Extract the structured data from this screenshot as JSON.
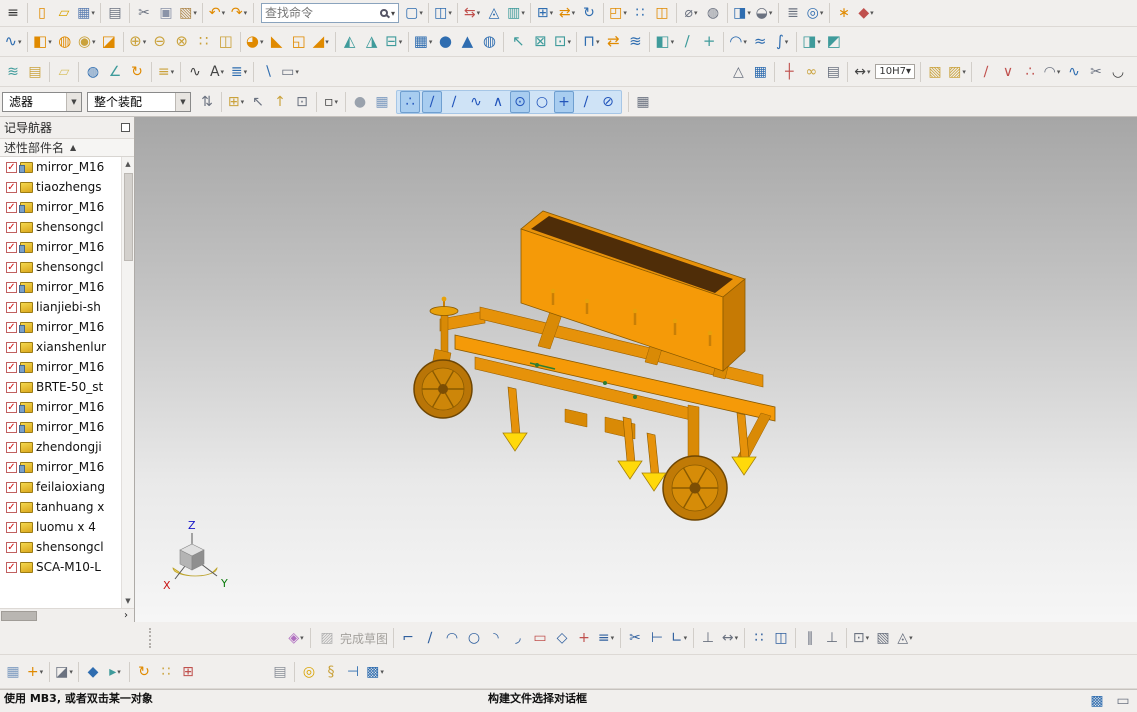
{
  "search": {
    "placeholder": "查找命令"
  },
  "filters": {
    "selection_filter": "滤器",
    "scope": "整个装配"
  },
  "navigator": {
    "title": "记导航器",
    "column_header": "述性部件名",
    "sort_indicator": "▲",
    "check_glyph": "✓",
    "scroll": {
      "up": "▲",
      "down": "▼",
      "right": "›"
    },
    "items": [
      {
        "label": "mirror_M16",
        "icon": "mirror",
        "checked": true
      },
      {
        "label": "tiaozhengs",
        "icon": "part",
        "checked": true
      },
      {
        "label": "mirror_M16",
        "icon": "mirror",
        "checked": true
      },
      {
        "label": "shensongcl",
        "icon": "part",
        "checked": true
      },
      {
        "label": "mirror_M16",
        "icon": "mirror",
        "checked": true
      },
      {
        "label": "shensongcl",
        "icon": "part",
        "checked": true
      },
      {
        "label": "mirror_M16",
        "icon": "mirror",
        "checked": true
      },
      {
        "label": "lianjiebi-sh",
        "icon": "part",
        "checked": true
      },
      {
        "label": "mirror_M16",
        "icon": "mirror",
        "checked": true
      },
      {
        "label": "xianshenlur",
        "icon": "part",
        "checked": true
      },
      {
        "label": "mirror_M16",
        "icon": "mirror",
        "checked": true
      },
      {
        "label": "BRTE-50_st",
        "icon": "part",
        "checked": true
      },
      {
        "label": "mirror_M16",
        "icon": "mirror",
        "checked": true
      },
      {
        "label": "mirror_M16",
        "icon": "mirror",
        "checked": true
      },
      {
        "label": "zhendongji",
        "icon": "part",
        "checked": true
      },
      {
        "label": "mirror_M16",
        "icon": "mirror",
        "checked": true
      },
      {
        "label": "feilaioxiang",
        "icon": "part",
        "checked": true
      },
      {
        "label": "tanhuang x",
        "icon": "part",
        "checked": true
      },
      {
        "label": "luomu x 4",
        "icon": "part",
        "checked": true
      },
      {
        "label": "shensongcl",
        "icon": "part",
        "checked": true
      },
      {
        "label": "SCA-M10-L",
        "icon": "part",
        "checked": true
      }
    ]
  },
  "sketch_toolbar": {
    "finish_label": "完成草图"
  },
  "triad": {
    "x": "X",
    "y": "Y",
    "z": "Z"
  },
  "status_bar": {
    "left": "使用 MB3, 或者双击某一对象",
    "center": "构建文件选择对话框"
  },
  "colors": {
    "selection_highlight": "#cfe3f6",
    "model_orange": "#f59a08",
    "model_yellow": "#ffd90a"
  },
  "toolbars": {
    "row1_left": [
      {
        "n": "menu",
        "g": "≡",
        "c": "#333333"
      },
      {
        "t": "sep"
      },
      {
        "n": "new-file",
        "g": "▯",
        "c": "#e08a00"
      },
      {
        "n": "open-file",
        "g": "▱",
        "c": "#d9a300"
      },
      {
        "n": "save-file",
        "g": "▦",
        "c": "#5b7db1",
        "d": 1
      },
      {
        "t": "sep"
      },
      {
        "n": "print",
        "g": "▤",
        "c": "#6b7280"
      },
      {
        "t": "sep"
      },
      {
        "n": "cut",
        "g": "✂",
        "c": "#6b7280"
      },
      {
        "n": "copy",
        "g": "▣",
        "c": "#8a93a8"
      },
      {
        "n": "paste",
        "g": "▧",
        "c": "#b08a50",
        "d": 1
      },
      {
        "t": "sep"
      },
      {
        "n": "undo",
        "g": "↶",
        "c": "#e08a00",
        "d": 1
      },
      {
        "n": "redo",
        "g": "↷",
        "c": "#e08a00",
        "d": 1
      },
      {
        "t": "sep"
      }
    ],
    "row1_right": [
      {
        "n": "touch-mode",
        "g": "▢",
        "c": "#2f6db0",
        "d": 1
      },
      {
        "t": "sep"
      },
      {
        "n": "window-layout",
        "g": "◫",
        "c": "#2f6db0",
        "d": 1
      },
      {
        "t": "sep"
      },
      {
        "n": "move-object",
        "g": "⇆",
        "c": "#c0504d",
        "d": 1
      },
      {
        "n": "pmi",
        "g": "◬",
        "c": "#2f6db0"
      },
      {
        "n": "visual-report",
        "g": "▥",
        "c": "#3f9b9b",
        "d": 1
      },
      {
        "t": "sep"
      },
      {
        "n": "assembly-arrangements",
        "g": "⊞",
        "c": "#2f6db0",
        "d": 1
      },
      {
        "n": "move-component",
        "g": "⇄",
        "c": "#e08a00",
        "d": 1
      },
      {
        "n": "degrees-of-freedom",
        "g": "↻",
        "c": "#2f6db0"
      },
      {
        "t": "sep"
      },
      {
        "n": "new-component",
        "g": "◰",
        "c": "#e08a00",
        "d": 1
      },
      {
        "n": "pattern-component",
        "g": "∷",
        "c": "#2f6db0"
      },
      {
        "n": "mirror-assembly",
        "g": "◫",
        "c": "#e08a00"
      },
      {
        "t": "sep"
      },
      {
        "n": "measure-distance",
        "g": "⌀",
        "c": "#6b7280",
        "d": 1
      },
      {
        "n": "analysis",
        "g": "◍",
        "c": "#6b7280"
      },
      {
        "t": "sep"
      },
      {
        "n": "orient-view",
        "g": "◨",
        "c": "#2f6db0",
        "d": 1
      },
      {
        "n": "render-style",
        "g": "◒",
        "c": "#6b7280",
        "d": 1
      },
      {
        "t": "sep"
      },
      {
        "n": "layer-settings",
        "g": "≣",
        "c": "#6b7280"
      },
      {
        "n": "show-hide",
        "g": "◎",
        "c": "#2f6db0",
        "d": 1
      },
      {
        "t": "sep"
      },
      {
        "n": "user-tools",
        "g": "∗",
        "c": "#e08a00"
      },
      {
        "n": "touch-panel",
        "g": "◆",
        "c": "#c0504d",
        "d": 1
      }
    ],
    "row2": [
      {
        "n": "direct-sketch",
        "g": "∿",
        "c": "#2f6db0",
        "d": 1
      },
      {
        "t": "sep"
      },
      {
        "n": "extrude",
        "g": "◧",
        "c": "#e08a00",
        "d": 1
      },
      {
        "n": "revolve",
        "g": "◍",
        "c": "#e08a00"
      },
      {
        "n": "hole",
        "g": "◉",
        "c": "#caa23c",
        "d": 1
      },
      {
        "n": "rib",
        "g": "◪",
        "c": "#e08a00"
      },
      {
        "t": "sep"
      },
      {
        "n": "unite",
        "g": "⊕",
        "c": "#caa23c",
        "d": 1
      },
      {
        "n": "subtract",
        "g": "⊖",
        "c": "#caa23c"
      },
      {
        "n": "intersect",
        "g": "⊗",
        "c": "#caa23c"
      },
      {
        "n": "pattern-feature",
        "g": "∷",
        "c": "#caa23c"
      },
      {
        "n": "mirror-feature",
        "g": "◫",
        "c": "#caa23c"
      },
      {
        "t": "sep"
      },
      {
        "n": "edge-blend",
        "g": "◕",
        "c": "#e08a00",
        "d": 1
      },
      {
        "n": "chamfer",
        "g": "◣",
        "c": "#e08a00"
      },
      {
        "n": "shell",
        "g": "◱",
        "c": "#e08a00"
      },
      {
        "n": "draft",
        "g": "◢",
        "c": "#e08a00",
        "d": 1
      },
      {
        "t": "sep"
      },
      {
        "n": "trim-body",
        "g": "◭",
        "c": "#3f9b9b"
      },
      {
        "n": "split-body",
        "g": "◮",
        "c": "#3f9b9b"
      },
      {
        "n": "offset-face",
        "g": "⊟",
        "c": "#3f9b9b",
        "d": 1
      },
      {
        "t": "sep"
      },
      {
        "n": "block",
        "g": "▦",
        "c": "#2f6db0",
        "d": 1
      },
      {
        "n": "cylinder",
        "g": "●",
        "c": "#2f6db0"
      },
      {
        "n": "cone",
        "g": "▲",
        "c": "#2f6db0"
      },
      {
        "n": "sphere",
        "g": "◍",
        "c": "#2f6db0"
      },
      {
        "t": "sep"
      },
      {
        "n": "move-face",
        "g": "↖",
        "c": "#3f9b9b"
      },
      {
        "n": "delete-face",
        "g": "⊠",
        "c": "#3f9b9b"
      },
      {
        "n": "replace-face",
        "g": "⊡",
        "c": "#3f9b9b",
        "d": 1
      },
      {
        "t": "sep"
      },
      {
        "n": "assembly-constraints",
        "g": "⊓",
        "c": "#2f6db0",
        "d": 1
      },
      {
        "n": "move-assembly",
        "g": "⇄",
        "c": "#e08a00"
      },
      {
        "n": "wave-link",
        "g": "≋",
        "c": "#2f6db0"
      },
      {
        "t": "sep"
      },
      {
        "n": "datum-plane",
        "g": "◧",
        "c": "#3f9b9b",
        "d": 1
      },
      {
        "n": "datum-axis",
        "g": "∕",
        "c": "#3f9b9b"
      },
      {
        "n": "point-tool",
        "g": "+",
        "c": "#3f9b9b"
      },
      {
        "t": "sep"
      },
      {
        "n": "ruled-surface",
        "g": "◠",
        "c": "#2f6db0",
        "d": 1
      },
      {
        "n": "through-curves",
        "g": "≈",
        "c": "#2f6db0"
      },
      {
        "n": "swept",
        "g": "∫",
        "c": "#2f6db0",
        "d": 1
      },
      {
        "t": "sep"
      },
      {
        "n": "section-view",
        "g": "◨",
        "c": "#3f9b9b",
        "d": 1
      },
      {
        "n": "edit-section",
        "g": "◩",
        "c": "#3f9b9b"
      }
    ],
    "row3_left": [
      {
        "n": "layer-category",
        "g": "≋",
        "c": "#3f9b9b"
      },
      {
        "n": "view-layout",
        "g": "▤",
        "c": "#caa23c"
      },
      {
        "t": "sep"
      },
      {
        "n": "note-editor",
        "g": "▱",
        "c": "#d9c36a"
      },
      {
        "t": "sep"
      },
      {
        "n": "wave-geometry-linker",
        "g": "◍",
        "c": "#2f6db0"
      },
      {
        "n": "edit-feature",
        "g": "∠",
        "c": "#3f9b9b"
      },
      {
        "n": "update-model",
        "g": "↻",
        "c": "#e08a00"
      },
      {
        "t": "sep"
      },
      {
        "n": "expressions",
        "g": "≡",
        "c": "#caa23c",
        "d": 1
      },
      {
        "t": "sep"
      },
      {
        "n": "studio-spline",
        "g": "∿",
        "c": "#444444"
      },
      {
        "n": "text-curve",
        "g": "A",
        "c": "#444444",
        "d": 1
      },
      {
        "n": "information-list",
        "g": "≣",
        "c": "#2f6db0",
        "d": 1
      },
      {
        "t": "sep"
      },
      {
        "n": "pen-tool",
        "g": "∖",
        "c": "#2f6db0"
      },
      {
        "n": "eraser-tool",
        "g": "▭",
        "c": "#6b7280",
        "d": 1
      }
    ],
    "row3_right": [
      {
        "n": "tolerance-triangle",
        "g": "△",
        "c": "#6b7280"
      },
      {
        "n": "parts-table",
        "g": "▦",
        "c": "#2f6db0"
      },
      {
        "t": "sep"
      },
      {
        "n": "anchor-point",
        "g": "┼",
        "c": "#c0504d"
      },
      {
        "n": "gear-pair",
        "g": "∞",
        "c": "#caa23c"
      },
      {
        "n": "annotation-editor",
        "g": "▤",
        "c": "#6b7280"
      },
      {
        "t": "sep"
      },
      {
        "n": "linear-dimension",
        "g": "↔",
        "c": "#444444",
        "d": 1
      },
      {
        "t": "chip",
        "n": "fit-tolerance",
        "label": "10H7",
        "d": 1
      },
      {
        "t": "sep"
      },
      {
        "n": "pattern-gold",
        "g": "▧",
        "c": "#caa23c"
      },
      {
        "n": "pattern-gold-alt",
        "g": "▨",
        "c": "#caa23c",
        "d": 1
      },
      {
        "t": "sep"
      },
      {
        "n": "sketch-line",
        "g": "∕",
        "c": "#c0504d"
      },
      {
        "n": "sketch-polyline",
        "g": "∨",
        "c": "#c0504d"
      },
      {
        "n": "point-set",
        "g": "∴",
        "c": "#c0504d"
      },
      {
        "n": "bridge-curve",
        "g": "◠",
        "c": "#6b7280",
        "d": 1
      },
      {
        "n": "curve-wave",
        "g": "∿",
        "c": "#2f6db0"
      },
      {
        "n": "trim-curve",
        "g": "✂",
        "c": "#6b7280"
      },
      {
        "n": "arc-tool",
        "g": "◡",
        "c": "#444444"
      }
    ],
    "row4_mid": [
      {
        "n": "selection-stack",
        "g": "⇅",
        "c": "#6b7280"
      },
      {
        "t": "sep"
      },
      {
        "n": "add-to-selection",
        "g": "⊞",
        "c": "#caa23c",
        "d": 1
      },
      {
        "n": "select-previous",
        "g": "↖",
        "c": "#6b7280"
      },
      {
        "n": "select-parent",
        "g": "↑",
        "c": "#caa23c"
      },
      {
        "n": "select-group",
        "g": "⊡",
        "c": "#6b7280"
      },
      {
        "t": "sep"
      },
      {
        "n": "marquee-select",
        "g": "▫",
        "c": "#444444",
        "d": 1
      },
      {
        "t": "sep"
      },
      {
        "n": "highlight-ball",
        "g": "●",
        "c": "#9aa2ad"
      },
      {
        "n": "wireframe-cube",
        "g": "▦",
        "c": "#7d9bc0"
      }
    ],
    "row4_snap": [
      {
        "n": "snap-point-enable",
        "g": "∴",
        "c": "#2255bb",
        "on": 1
      },
      {
        "n": "snap-endpoint",
        "g": "∕",
        "c": "#2255bb",
        "on": 1
      },
      {
        "n": "snap-midpoint",
        "g": "∕",
        "c": "#2255bb"
      },
      {
        "n": "snap-control-point",
        "g": "∿",
        "c": "#2255bb"
      },
      {
        "n": "snap-intersection",
        "g": "∧",
        "c": "#2255bb"
      },
      {
        "n": "snap-arc-center",
        "g": "⊙",
        "c": "#2255bb",
        "on": 1
      },
      {
        "n": "snap-quadrant",
        "g": "○",
        "c": "#2255bb"
      },
      {
        "n": "snap-existing-point",
        "g": "+",
        "c": "#2255bb",
        "on": 1
      },
      {
        "n": "snap-point-on-curve",
        "g": "∕",
        "c": "#2255bb"
      },
      {
        "n": "snap-point-on-face",
        "g": "⊘",
        "c": "#2255bb"
      }
    ],
    "row4_end": [
      {
        "t": "sep"
      },
      {
        "n": "grid-display",
        "g": "▦",
        "c": "#6b7280"
      }
    ],
    "sketch_row_a": [
      {
        "n": "sketch-scene-palette",
        "g": "◈",
        "c": "#b06fc0",
        "d": 1
      },
      {
        "t": "sep"
      }
    ],
    "sketch_row_b": [
      {
        "t": "sep"
      },
      {
        "n": "profile",
        "g": "⌐",
        "c": "#2f5f9e"
      },
      {
        "n": "line",
        "g": "∕",
        "c": "#2f5f9e"
      },
      {
        "n": "arc",
        "g": "◠",
        "c": "#2f5f9e"
      },
      {
        "n": "circle",
        "g": "○",
        "c": "#2f5f9e"
      },
      {
        "n": "fillet",
        "g": "◝",
        "c": "#2f5f9e"
      },
      {
        "n": "chamfer-sketch",
        "g": "◞",
        "c": "#2f5f9e"
      },
      {
        "n": "rectangle",
        "g": "▭",
        "c": "#c0504d"
      },
      {
        "n": "polygon",
        "g": "◇",
        "c": "#2f5f9e"
      },
      {
        "n": "sketch-point",
        "g": "+",
        "c": "#c0504d"
      },
      {
        "n": "offset-curve",
        "g": "≡",
        "c": "#2f5f9e",
        "d": 1
      },
      {
        "t": "sep"
      },
      {
        "n": "quick-trim",
        "g": "✂",
        "c": "#2f5f9e"
      },
      {
        "n": "quick-extend",
        "g": "⊢",
        "c": "#2f5f9e"
      },
      {
        "n": "make-corner",
        "g": "∟",
        "c": "#2f5f9e",
        "d": 1
      },
      {
        "t": "sep"
      },
      {
        "n": "geometric-constraints",
        "g": "⊥",
        "c": "#6b7280"
      },
      {
        "n": "rapid-dimension",
        "g": "↔",
        "c": "#6b7280",
        "d": 1
      },
      {
        "t": "sep"
      },
      {
        "n": "pattern-curve",
        "g": "∷",
        "c": "#2f5f9e"
      },
      {
        "n": "mirror-curve",
        "g": "◫",
        "c": "#2f5f9e"
      },
      {
        "t": "sep"
      },
      {
        "n": "parallel-constraint",
        "g": "∥",
        "c": "#6b7280"
      },
      {
        "n": "perpendicular-constraint",
        "g": "⊥",
        "c": "#6b7280"
      },
      {
        "t": "sep"
      },
      {
        "n": "display-sketch-constraints",
        "g": "⊡",
        "c": "#6b7280",
        "d": 1
      },
      {
        "n": "constraint-settings",
        "g": "▧",
        "c": "#6b7280"
      },
      {
        "n": "sketch-options",
        "g": "◬",
        "c": "#6b7280",
        "d": 1
      }
    ],
    "bottom_row": [
      {
        "n": "datum-csys",
        "g": "▦",
        "c": "#7d9bc0"
      },
      {
        "n": "datum-plus",
        "g": "+",
        "c": "#e08a00",
        "d": 1
      },
      {
        "t": "sep"
      },
      {
        "n": "format-painter",
        "g": "◪",
        "c": "#6b7280",
        "d": 1
      },
      {
        "t": "sep"
      },
      {
        "n": "kinematics-joint",
        "g": "◆",
        "c": "#2f6db0"
      },
      {
        "n": "play-animation",
        "g": "▸",
        "c": "#3f9b9b",
        "d": 1
      },
      {
        "t": "sep"
      },
      {
        "n": "refresh-view",
        "g": "↻",
        "c": "#e08a00"
      },
      {
        "n": "pattern-mini",
        "g": "∷",
        "c": "#caa23c"
      },
      {
        "n": "interpart-link",
        "g": "⊞",
        "c": "#c0504d"
      },
      {
        "t": "gap"
      },
      {
        "n": "sheet-body",
        "g": "▤",
        "c": "#8a8f98"
      },
      {
        "t": "sep"
      },
      {
        "n": "torus",
        "g": "◎",
        "c": "#d9a300"
      },
      {
        "n": "spring",
        "g": "§",
        "c": "#caa23c"
      },
      {
        "n": "probe-connector",
        "g": "⊣",
        "c": "#2f6db0"
      },
      {
        "n": "exploded-view-cube",
        "g": "▩",
        "c": "#2f6db0",
        "d": 1
      }
    ],
    "status_icons": [
      {
        "n": "web-status",
        "g": "▩",
        "c": "#2f6db0"
      },
      {
        "n": "dialog-rail",
        "g": "▭",
        "c": "#6b7280"
      }
    ]
  }
}
